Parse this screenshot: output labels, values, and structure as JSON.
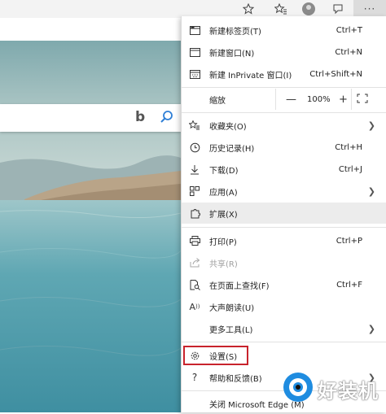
{
  "toolbar": {
    "icons": [
      "favorite-star-icon",
      "favorites-collection-icon",
      "profile-avatar",
      "feedback-icon",
      "settings-more-icon"
    ],
    "more_label": "···"
  },
  "search": {
    "logo": "b"
  },
  "menu": {
    "new_tab": {
      "label": "新建标签页(T)",
      "shortcut": "Ctrl+T"
    },
    "new_window": {
      "label": "新建窗口(N)",
      "shortcut": "Ctrl+N"
    },
    "new_inprivate": {
      "label": "新建 InPrivate 窗口(I)",
      "shortcut": "Ctrl+Shift+N"
    },
    "zoom": {
      "label": "缩放",
      "minus": "—",
      "value": "100%",
      "plus": "+"
    },
    "favorites": {
      "label": "收藏夹(O)"
    },
    "history": {
      "label": "历史记录(H)",
      "shortcut": "Ctrl+H"
    },
    "downloads": {
      "label": "下载(D)",
      "shortcut": "Ctrl+J"
    },
    "apps": {
      "label": "应用(A)"
    },
    "extensions": {
      "label": "扩展(X)"
    },
    "print": {
      "label": "打印(P)",
      "shortcut": "Ctrl+P"
    },
    "share": {
      "label": "共享(R)"
    },
    "find": {
      "label": "在页面上查找(F)",
      "shortcut": "Ctrl+F"
    },
    "read_aloud": {
      "label": "大声朗读(U)"
    },
    "more_tools": {
      "label": "更多工具(L)"
    },
    "settings": {
      "label": "设置(S)"
    },
    "help": {
      "label": "帮助和反馈(B)"
    },
    "close": {
      "label": "关闭 Microsoft Edge (M)"
    }
  },
  "watermark": {
    "text": "好装机"
  },
  "colors": {
    "highlight_box": "#c8232c",
    "menu_bg": "#ffffff",
    "hover_row": "#ececec"
  }
}
